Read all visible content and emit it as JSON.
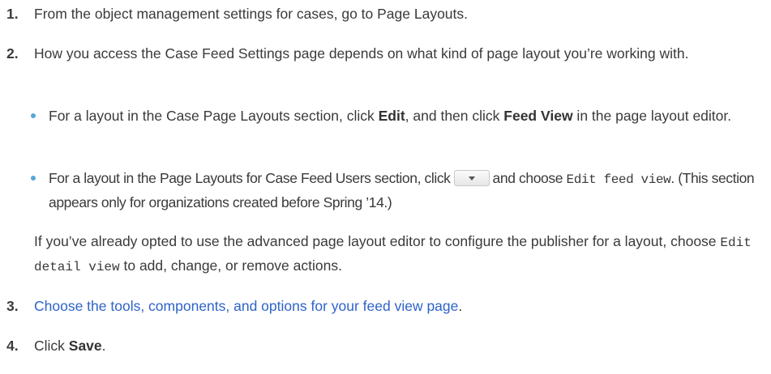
{
  "steps": [
    {
      "number": "1.",
      "text": "From the object management settings for cases, go to Page Layouts."
    },
    {
      "number": "2.",
      "text": "How you access the Case Feed Settings page depends on what kind of page layout you’re working with.",
      "bullets": [
        {
          "pre": "For a layout in the Case Page Layouts section, click ",
          "bold1": "Edit",
          "mid": ", and then click ",
          "bold2": "Feed View",
          "post": " in the page layout editor."
        },
        {
          "pre": "For a layout in the Page Layouts for Case Feed Users section, click",
          "menu_icon": "dropdown-menu-icon",
          "mid": "and choose ",
          "code": "Edit feed view",
          "post": ". (This section appears only for organizations created before Spring ’14.)"
        }
      ],
      "note": {
        "pre": "If you’ve already opted to use the advanced page layout editor to configure the publisher for a layout, choose ",
        "code": "Edit detail view",
        "post": " to add, change, or remove actions."
      }
    },
    {
      "number": "3.",
      "link_text": "Choose the tools, components, and options for your feed view page",
      "post": "."
    },
    {
      "number": "4.",
      "pre": "Click ",
      "bold": "Save",
      "post": "."
    }
  ],
  "colors": {
    "text": "#3a3a3a",
    "link": "#2e63c9",
    "bullet": "#55a6d8"
  }
}
